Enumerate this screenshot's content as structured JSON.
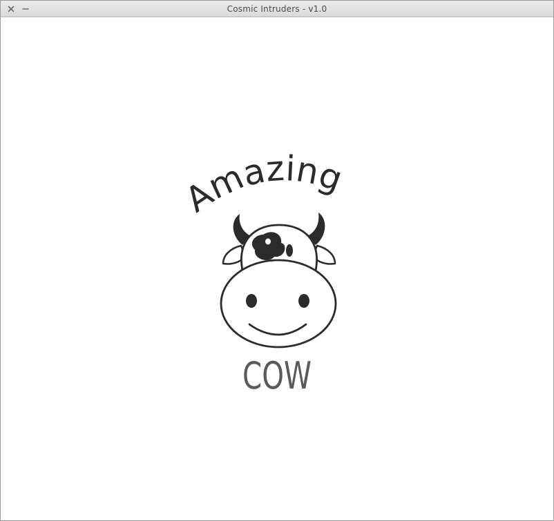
{
  "window": {
    "title": "Cosmic Intruders - v1.0",
    "close_icon": "close-icon",
    "minimize_icon": "minimize-icon"
  },
  "splash": {
    "logo_line1": "Amazing",
    "logo_line2": "COW",
    "text_color": "#2b2b2b",
    "subtitle_color": "#5a5a5a"
  }
}
